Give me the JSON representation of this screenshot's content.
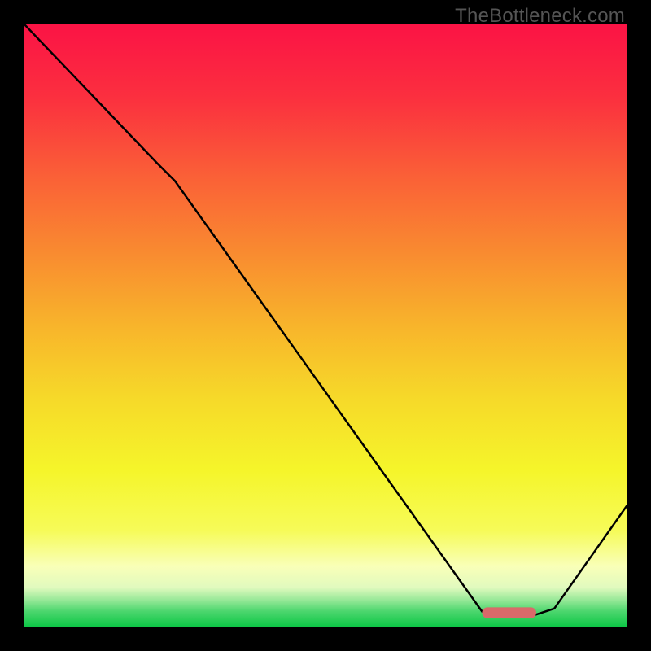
{
  "watermark": "TheBottleneck.com",
  "chart_data": {
    "type": "line",
    "title": "",
    "xlabel": "",
    "ylabel": "",
    "xlim": [
      0,
      100
    ],
    "ylim": [
      0,
      100
    ],
    "grid": false,
    "legend": false,
    "series": [
      {
        "name": "curve",
        "x": [
          0,
          22,
          25,
          76,
          80,
          85,
          88,
          100
        ],
        "values": [
          100,
          77,
          74,
          2.5,
          2,
          2,
          3,
          20
        ]
      }
    ],
    "optimal_segment": {
      "name": "optimal-range-marker",
      "x_start": 76,
      "x_end": 85,
      "y": 2.3,
      "color": "#d96a6a"
    },
    "background_gradient_stops": [
      {
        "pos": 0.0,
        "color": "#fb1345"
      },
      {
        "pos": 0.12,
        "color": "#fb2f3f"
      },
      {
        "pos": 0.25,
        "color": "#fa5f37"
      },
      {
        "pos": 0.38,
        "color": "#f98b30"
      },
      {
        "pos": 0.5,
        "color": "#f8b42b"
      },
      {
        "pos": 0.62,
        "color": "#f6d929"
      },
      {
        "pos": 0.74,
        "color": "#f5f52a"
      },
      {
        "pos": 0.84,
        "color": "#f6fb58"
      },
      {
        "pos": 0.9,
        "color": "#f9ffb8"
      },
      {
        "pos": 0.935,
        "color": "#e1fabe"
      },
      {
        "pos": 0.955,
        "color": "#9ae999"
      },
      {
        "pos": 0.975,
        "color": "#4bd66d"
      },
      {
        "pos": 1.0,
        "color": "#0ec747"
      }
    ]
  }
}
